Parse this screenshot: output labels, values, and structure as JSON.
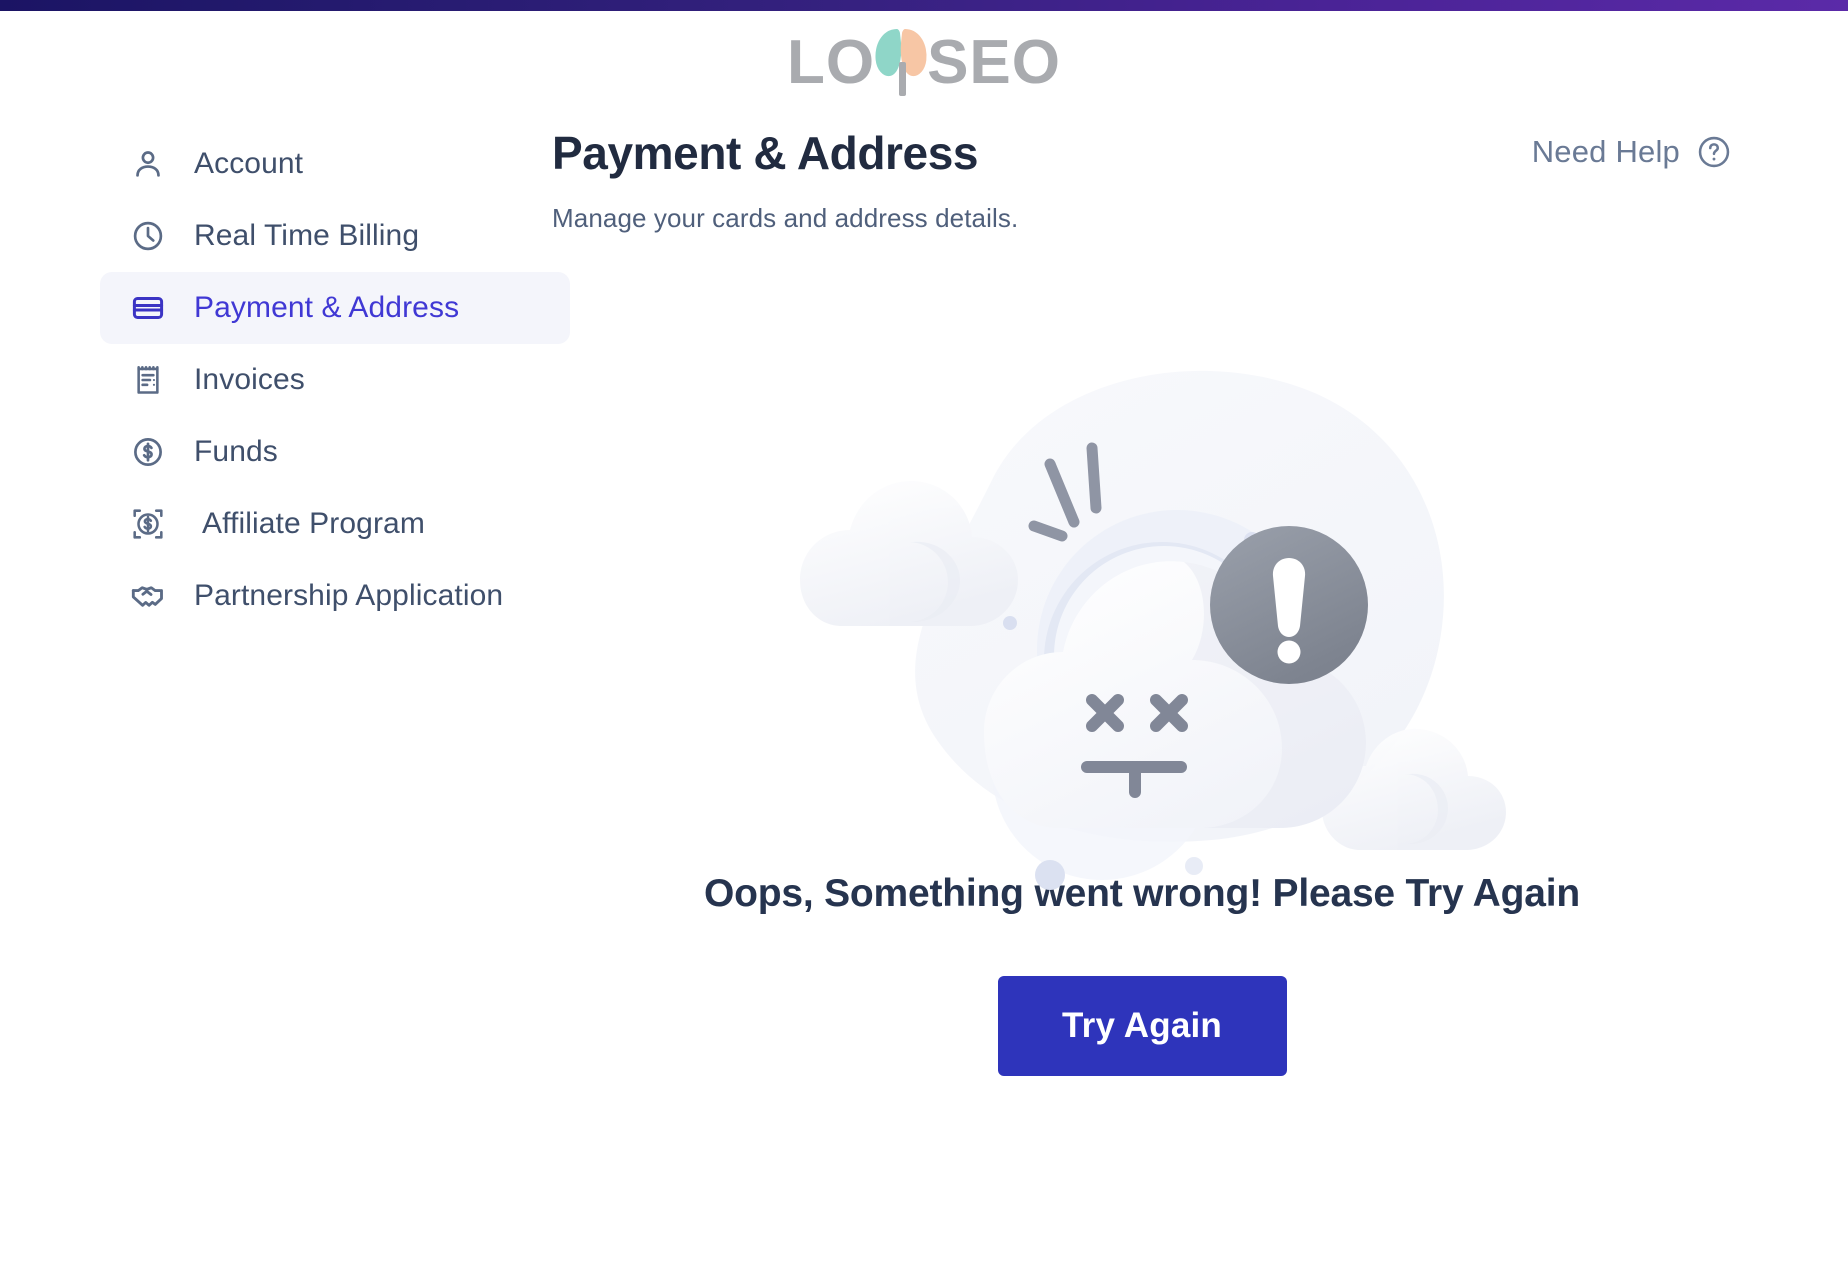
{
  "brand": {
    "logo_text_left": "LO",
    "logo_text_right": "SEO",
    "logo_name": "LOYSEO",
    "accent_top_bar_left": "#1b1464",
    "accent_top_bar_right": "#5b2aa8",
    "petal_left_color": "#8fd6c8",
    "petal_right_color": "#f7c6a5",
    "logo_gray": "#a9abaf"
  },
  "sidebar": {
    "items": [
      {
        "label": "Account",
        "icon": "user-icon",
        "active": false
      },
      {
        "label": "Real Time Billing",
        "icon": "clock-icon",
        "active": false
      },
      {
        "label": "Payment & Address",
        "icon": "credit-card-icon",
        "active": true
      },
      {
        "label": "Invoices",
        "icon": "receipt-icon",
        "active": false
      },
      {
        "label": "Funds",
        "icon": "dollar-circle-icon",
        "active": false
      },
      {
        "label": "Affiliate Program",
        "icon": "dollar-target-icon",
        "active": false
      },
      {
        "label": "Partnership Application",
        "icon": "handshake-icon",
        "active": false
      }
    ],
    "active_bg": "#f4f5fb",
    "active_text": "#4038d4",
    "text_color": "#3f4f6b"
  },
  "main": {
    "title": "Payment & Address",
    "subtitle": "Manage your cards and address details.",
    "need_help_label": "Need Help",
    "need_help_icon": "question-circle-icon"
  },
  "error_state": {
    "illustration": "broken-cloud-error-icon",
    "message": "Oops, Something went wrong! Please Try Again",
    "button_label": "Try Again",
    "button_color": "#2e34bb",
    "message_color": "#26344f"
  }
}
